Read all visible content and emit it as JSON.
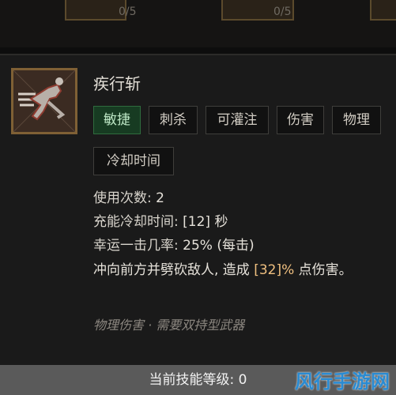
{
  "top_slots": [
    {
      "count": "0/5"
    },
    {
      "count": "0/5"
    }
  ],
  "skill": {
    "name": "疾行斩",
    "icon": "dash-slash-icon",
    "tags": [
      "敏捷",
      "刺杀",
      "可灌注",
      "伤害",
      "物理",
      "冷却时间"
    ],
    "stats": {
      "uses_label": "使用次数: ",
      "uses_value": "2",
      "cooldown_label": "充能冷却时间: ",
      "cooldown_value": "[12]",
      "cooldown_unit": " 秒",
      "luck_label": "幸运一击几率: ",
      "luck_value": "25%",
      "luck_suffix": " (每击)"
    },
    "description": {
      "part1": "冲向前方并劈砍敌人, 造成 ",
      "damage": "[32]%",
      "part2": " 点伤害。"
    },
    "footer": "物理伤害 · 需要双持型武器"
  },
  "level": {
    "text": "当前技能等级: 0"
  },
  "watermark": "风行手游网"
}
